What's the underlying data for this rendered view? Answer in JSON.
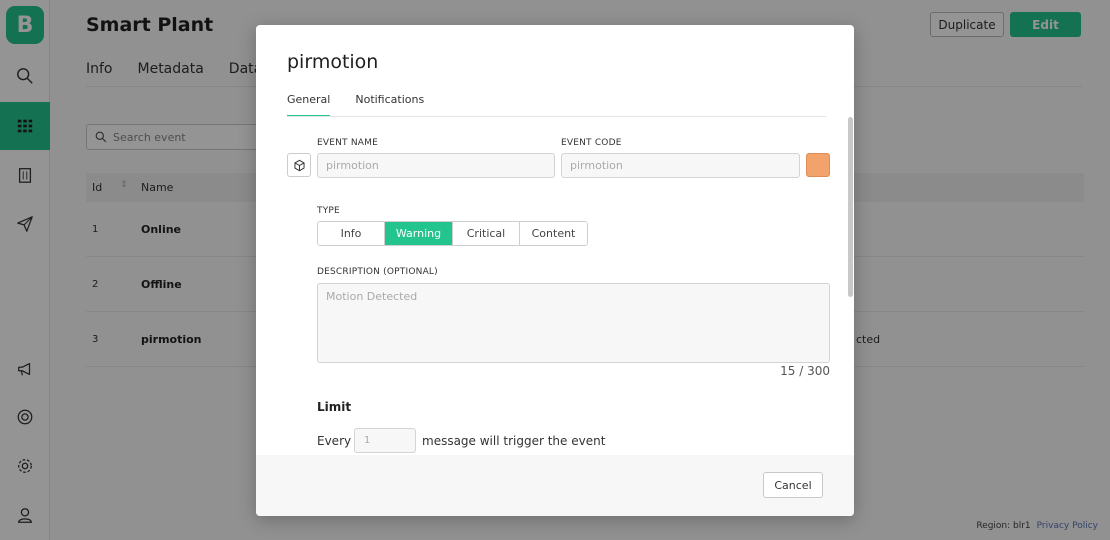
{
  "sidebar": {
    "logo": "B",
    "items": [
      {
        "name": "search-icon"
      },
      {
        "name": "grid-icon",
        "active": true
      },
      {
        "name": "building-icon"
      },
      {
        "name": "send-icon"
      },
      {
        "name": "megaphone-icon"
      },
      {
        "name": "lifebuoy-icon"
      },
      {
        "name": "gear-icon"
      },
      {
        "name": "user-icon"
      }
    ]
  },
  "page": {
    "title": "Smart Plant",
    "duplicate_label": "Duplicate",
    "edit_label": "Edit",
    "tabs": [
      "Info",
      "Metadata",
      "Datas"
    ],
    "search_placeholder": "Search event",
    "table": {
      "headers": {
        "id": "Id",
        "name": "Name"
      },
      "rows": [
        {
          "id": "1",
          "name": "Online",
          "desc": ""
        },
        {
          "id": "2",
          "name": "Offline",
          "desc": ""
        },
        {
          "id": "3",
          "name": "pirmotion",
          "desc": "cted"
        }
      ]
    },
    "footer": {
      "region": "Region: blr1",
      "privacy": "Privacy Policy"
    }
  },
  "modal": {
    "title": "pirmotion",
    "tabs": [
      {
        "label": "General",
        "active": true
      },
      {
        "label": "Notifications",
        "active": false
      }
    ],
    "event_name_label": "EVENT NAME",
    "event_name_placeholder": "pirmotion",
    "event_code_label": "EVENT CODE",
    "event_code_placeholder": "pirmotion",
    "color": "#f2a36b",
    "type_label": "TYPE",
    "types": [
      "Info",
      "Warning",
      "Critical",
      "Content"
    ],
    "selected_type": "Warning",
    "description_label": "DESCRIPTION (OPTIONAL)",
    "description_placeholder": "Motion Detected",
    "counter": "15 / 300",
    "limit_heading": "Limit",
    "every_label": "Every",
    "every_value": "1",
    "every_suffix": "message will trigger the event",
    "cancel_label": "Cancel"
  },
  "colors": {
    "accent": "#23c48e",
    "event_color": "#f2a36b"
  }
}
